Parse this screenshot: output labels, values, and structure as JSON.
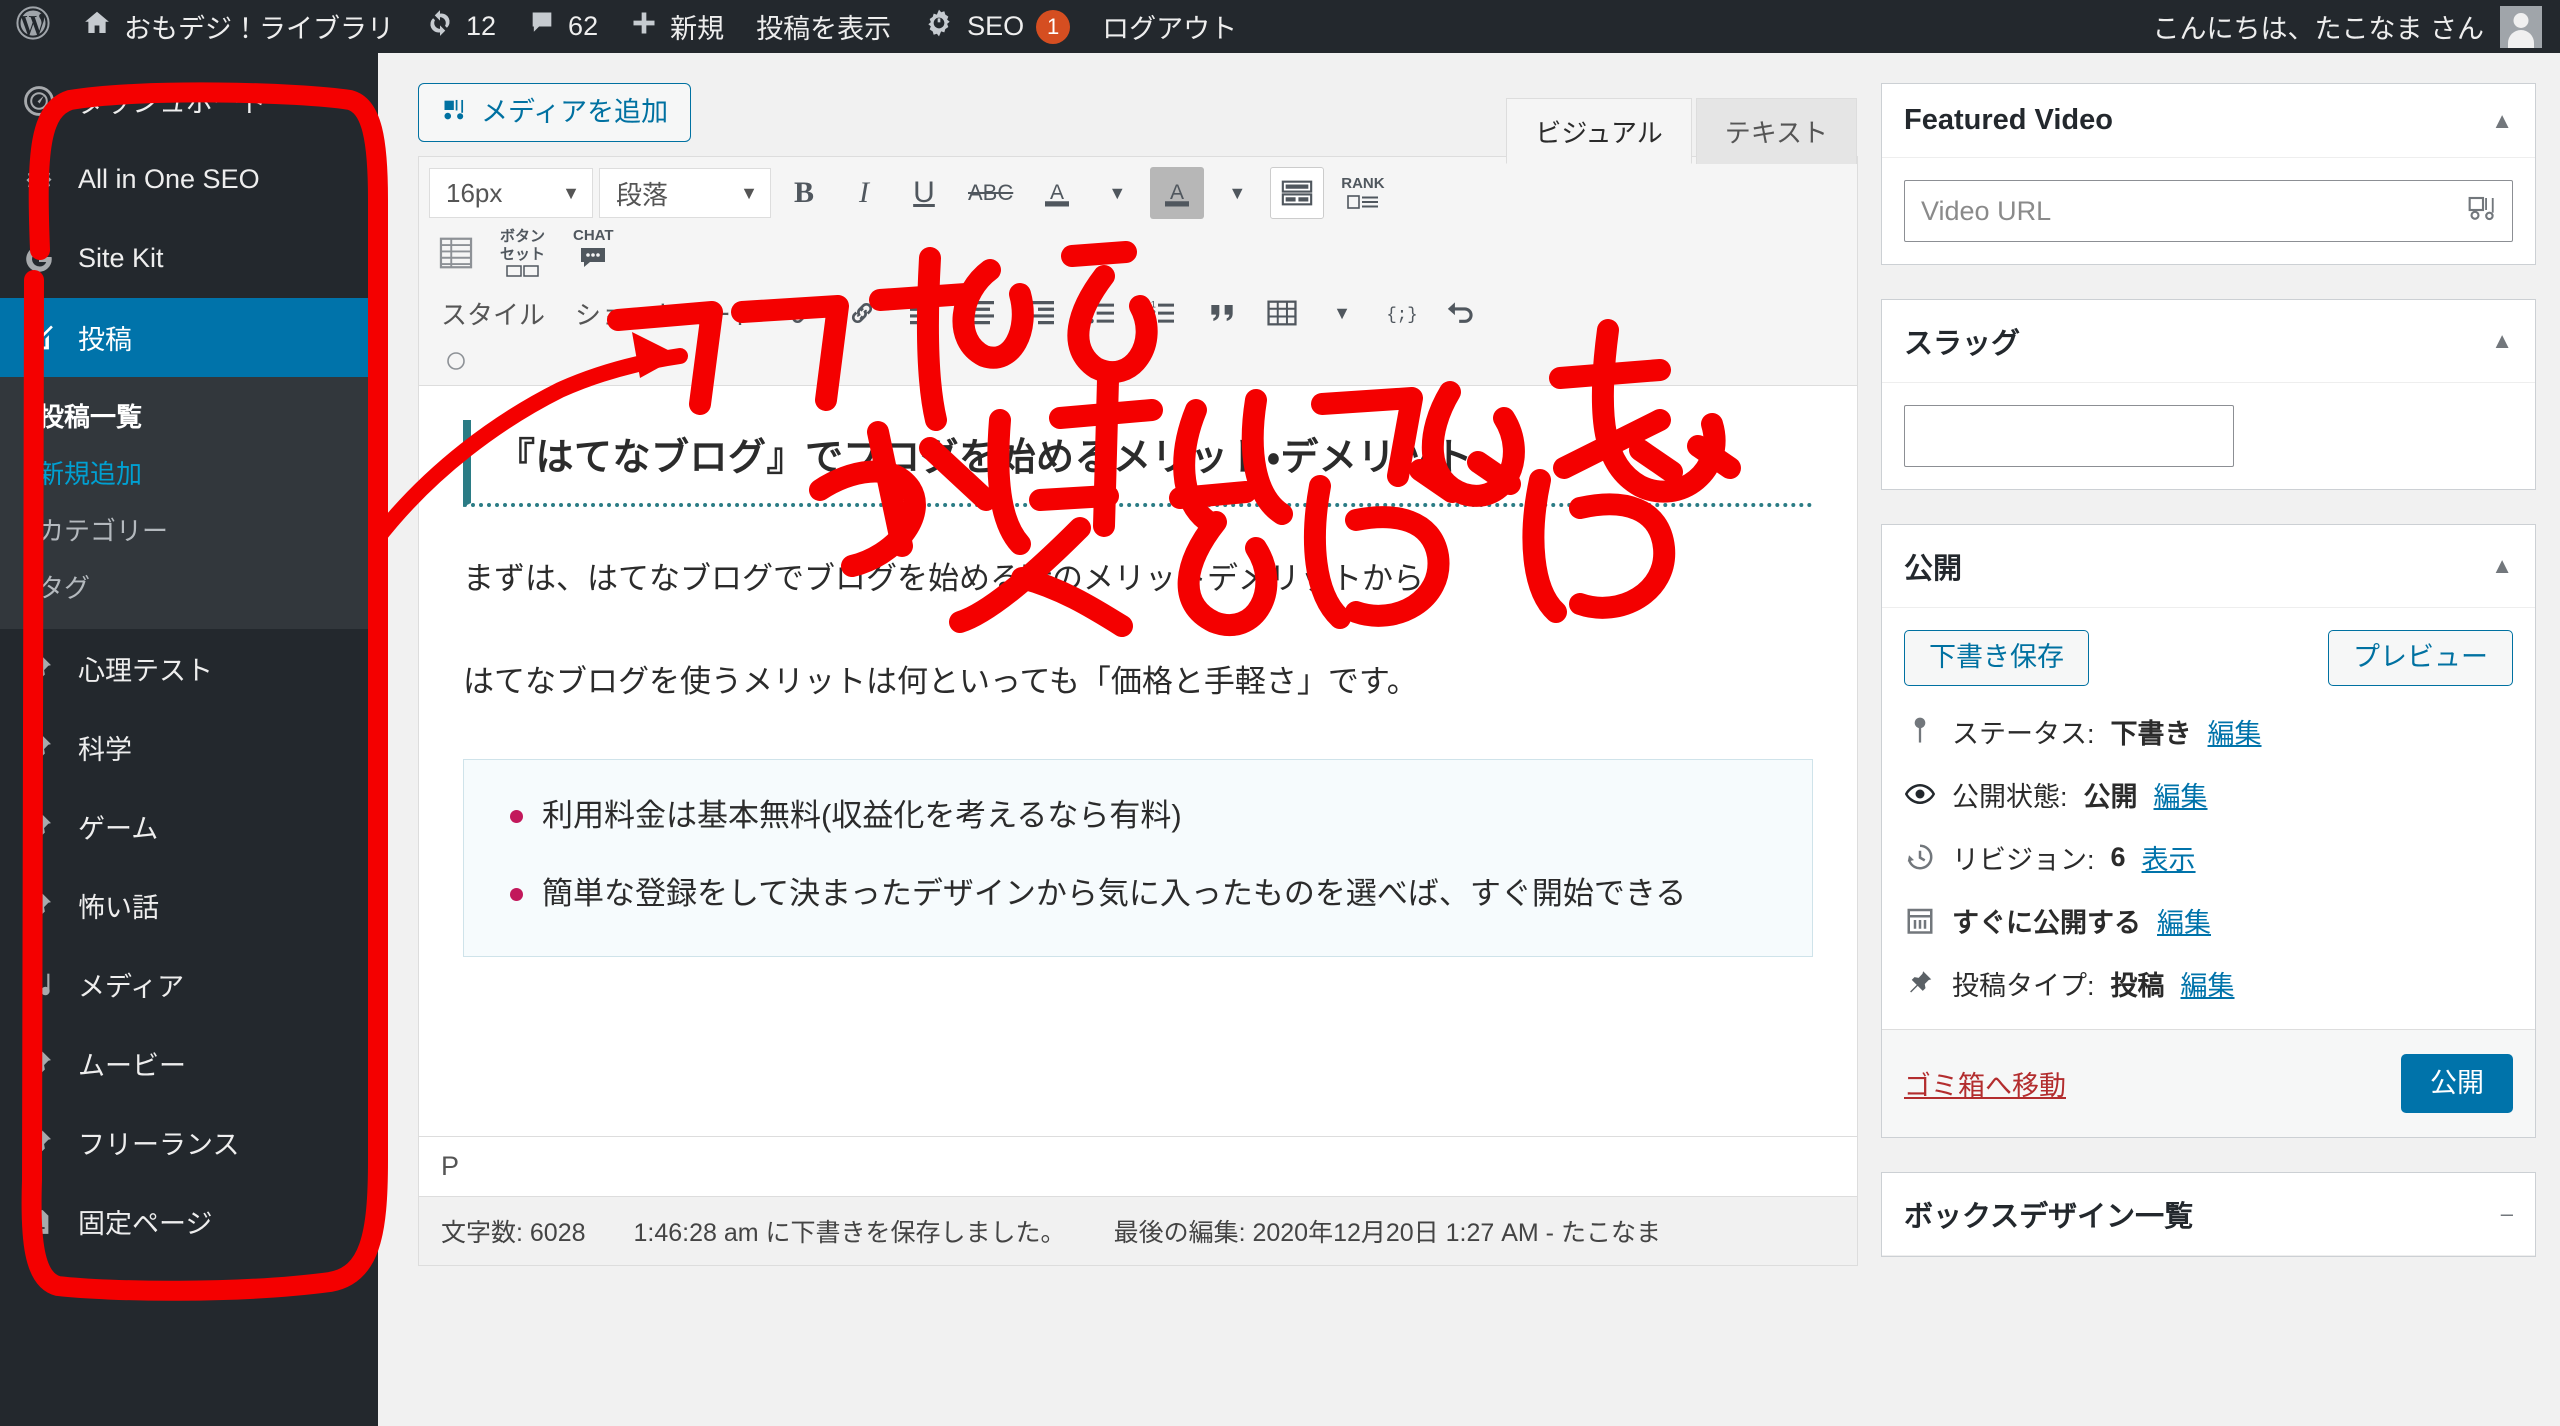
{
  "adminbar": {
    "logo_icon": "wordpress-logo-icon",
    "site_name": "おもデジ！ライブラリ",
    "site_icon": "home-icon",
    "updates_icon": "updates-icon",
    "updates_count": "12",
    "comments_icon": "comment-bubble-icon",
    "comments_count": "62",
    "new_icon": "plus-icon",
    "new_label": "新規",
    "view_post_label": "投稿を表示",
    "seo_icon": "gear-plug-icon",
    "seo_label": "SEO",
    "seo_count": "1",
    "logout_label": "ログアウト",
    "greeting": "こんにちは、たこなま さん",
    "avatar_icon": "avatar-icon"
  },
  "sidebar": {
    "top_items": [
      {
        "label": "ダッシュボード",
        "icon": "dashboard-gauge-icon",
        "current": false
      },
      {
        "label": "All in One SEO",
        "icon": "gear-plug-icon",
        "current": false
      },
      {
        "label": "Site Kit",
        "icon": "google-g-icon",
        "current": false
      },
      {
        "label": "投稿",
        "icon": "pencil-post-icon",
        "current": true
      }
    ],
    "submenu": [
      {
        "label": "投稿一覧",
        "state": "first"
      },
      {
        "label": "新規追加",
        "state": "active"
      },
      {
        "label": "カテゴリー",
        "state": ""
      },
      {
        "label": "タグ",
        "state": ""
      }
    ],
    "bottom_items": [
      {
        "label": "心理テスト",
        "icon": "pin-icon"
      },
      {
        "label": "科学",
        "icon": "pin-icon"
      },
      {
        "label": "ゲーム",
        "icon": "pin-icon"
      },
      {
        "label": "怖い話",
        "icon": "pin-icon"
      },
      {
        "label": "メディア",
        "icon": "media-icon"
      },
      {
        "label": "ムービー",
        "icon": "pin-icon"
      },
      {
        "label": "フリーランス",
        "icon": "pin-icon"
      },
      {
        "label": "固定ページ",
        "icon": "page-icon"
      }
    ]
  },
  "editor": {
    "add_media_label": "メディアを追加",
    "add_media_icon": "media-add-icon",
    "tabs": [
      {
        "label": "ビジュアル",
        "active": true
      },
      {
        "label": "テキスト",
        "active": false
      }
    ],
    "toolbar": {
      "font_size": "16px",
      "format": "段落",
      "bold": "B",
      "italic": "I",
      "underline": "U",
      "strikethrough": "ABC",
      "text_color_icon": "text-color-a-icon",
      "highlight_color_icon": "highlight-color-a-icon",
      "table_icon": "table-grid-icon",
      "rank_label": "RANK",
      "rank_icon": "rank-math-icon",
      "list_table_icon": "list-table-icon",
      "button_set_label_1": "ボタン",
      "button_set_label_2": "セット",
      "chat_label": "CHAT",
      "chat_icon": "chat-bubble-icon",
      "style_label": "スタイル",
      "shortcode_label": "ショートコード",
      "link_icon": "link-icon",
      "unlink_icon": "unlink-icon",
      "align_left_icon": "align-left-icon",
      "align_center_icon": "align-center-icon",
      "align_right_icon": "align-right-icon",
      "ul_icon": "unordered-list-icon",
      "ol_icon": "ordered-list-icon",
      "quote_icon": "blockquote-icon",
      "table2_icon": "table-icon",
      "code_icon": "code-braces-icon",
      "undo_icon": "undo-icon"
    },
    "content": {
      "heading": "『はてなブログ』でブログを始めるメリット・デメリット",
      "paragraph_1": "まずは、はてなブログでブログを始める時のメリットデメリットから。",
      "paragraph_2": "はてなブログを使うメリットは何といっても「価格と手軽さ」です。",
      "list_items": [
        "利用料金は基本無料(収益化を考えるなら有料)",
        "簡単な登録をして決まったデザインから気に入ったものを選べば、すぐ開始できる"
      ]
    },
    "path_indicator": "P",
    "statusbar": {
      "word_count_label": "文字数: 6028",
      "autosave_text": "1:46:28 am に下書きを保存しました。",
      "last_edit_text": "最後の編集: 2020年12月20日 1:27 AM - たこなま"
    }
  },
  "right_sidebar": {
    "featured_video": {
      "title": "Featured Video",
      "toggle_icon": "triangle-up-icon",
      "url_placeholder": "Video URL",
      "url_value": "",
      "picker_icon": "media-picker-icon"
    },
    "slug": {
      "title": "スラッグ",
      "toggle_icon": "triangle-up-icon",
      "value": ""
    },
    "publish": {
      "title": "公開",
      "toggle_icon": "triangle-up-icon",
      "save_draft_label": "下書き保存",
      "preview_label": "プレビュー",
      "rows": [
        {
          "icon": "pin-status-icon",
          "label": "ステータス:",
          "value": "下書き",
          "link": "編集"
        },
        {
          "icon": "eye-icon",
          "label": "公開状態:",
          "value": "公開",
          "link": "編集"
        },
        {
          "icon": "clock-revision-icon",
          "label": "リビジョン:",
          "value": "6",
          "link": "表示"
        },
        {
          "icon": "calendar-icon",
          "label": "",
          "value": "すぐに公開する",
          "link": "編集"
        },
        {
          "icon": "pin-icon",
          "label": "投稿タイプ:",
          "value": "投稿",
          "link": "編集"
        }
      ],
      "trash_label": "ゴミ箱へ移動",
      "publish_label": "公開"
    },
    "bottom_box": {
      "title": "ボックスデザイン一覧",
      "toggle_icon": "minus-icon"
    }
  },
  "annotation": {
    "color": "#f40000",
    "text_line_1": "ココから",
    "text_line_2": "やりたいことを",
    "text_line_3": "えらぶだけ"
  }
}
